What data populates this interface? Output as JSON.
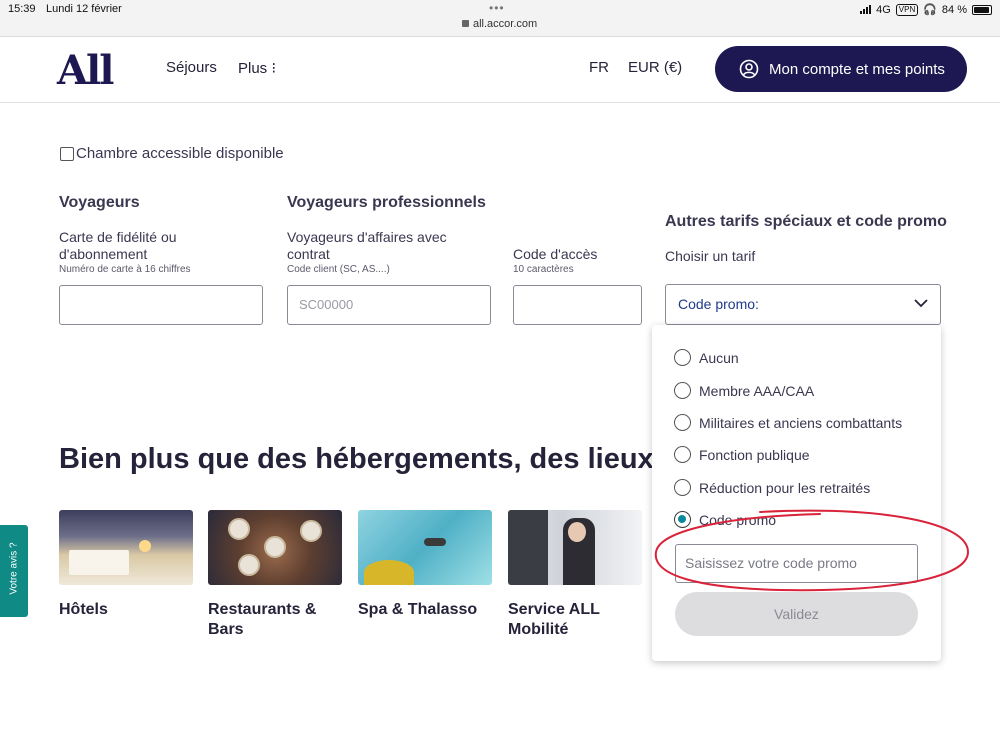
{
  "status_bar": {
    "time": "15:39",
    "date": "Lundi 12 février",
    "url": "all.accor.com",
    "network": "4G",
    "vpn": "VPN",
    "battery": "84 %",
    "battery_level": 0.84
  },
  "header": {
    "logo": "All",
    "nav": [
      "Séjours",
      "Plus"
    ],
    "language": "FR",
    "currency": "EUR (€)",
    "account_button": "Mon compte et mes points",
    "brand_color": "#1e1852"
  },
  "form": {
    "accessible_checkbox_label": "Chambre accessible disponible",
    "accessible_checked": false,
    "travelers": {
      "heading": "Voyageurs",
      "label": "Carte de fidélité ou d'abonnement",
      "hint": "Numéro de carte à 16 chiffres",
      "value": ""
    },
    "pro_travelers": {
      "heading": "Voyageurs professionnels",
      "label": "Voyageurs d'affaires avec contrat",
      "hint": "Code client (SC, AS....)",
      "placeholder": "SC00000",
      "access_label": "Code d'accès",
      "access_hint": "10 caractères",
      "access_value": ""
    },
    "special_rates": {
      "heading": "Autres tarifs spéciaux et code promo",
      "label": "Choisir un tarif",
      "selected": "Code promo:"
    }
  },
  "dropdown": {
    "options": [
      "Aucun",
      "Membre AAA/CAA",
      "Militaires et anciens combattants",
      "Fonction publique",
      "Réduction pour les retraités",
      "Code promo"
    ],
    "selected_index": 5,
    "promo_placeholder": "Saisissez votre code promo",
    "validate_button": "Validez",
    "radio_accent": "#0d8a9a"
  },
  "section": {
    "title": "Bien plus que des hébergements, des lieux"
  },
  "cards": [
    {
      "title": "Hôtels"
    },
    {
      "title": "Restaurants & Bars"
    },
    {
      "title": "Spa & Thalasso"
    },
    {
      "title": "Service ALL Mobilité"
    }
  ],
  "feedback_tab": "Votre avis ?",
  "annotation_color": "#d9233a"
}
